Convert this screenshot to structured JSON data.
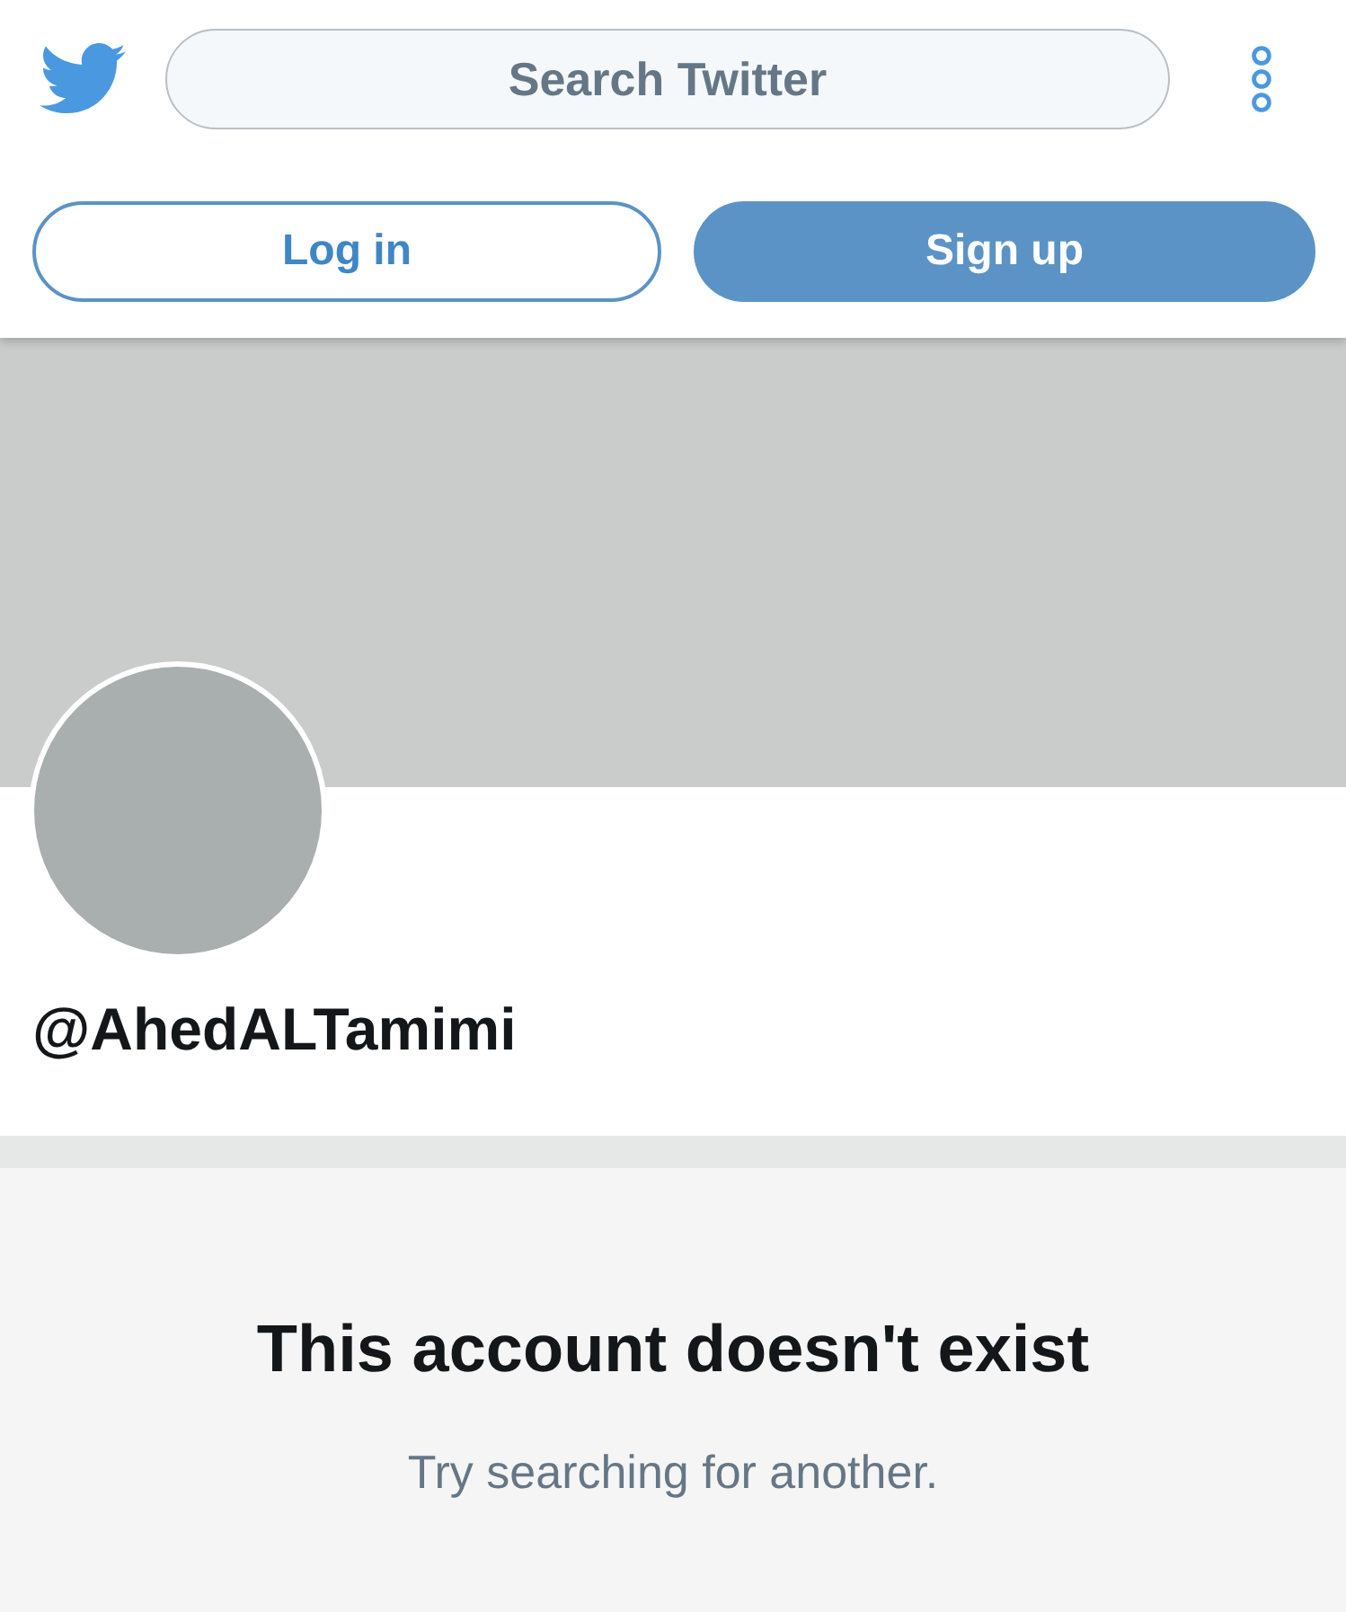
{
  "header": {
    "search": {
      "placeholder": "Search Twitter"
    }
  },
  "buttons": [
    {
      "label": "Log in",
      "kind": "outline"
    },
    {
      "label": "Sign up",
      "kind": "filled"
    }
  ],
  "profile": {
    "handle": "@AhedALTamimi"
  },
  "message": {
    "title": "This account doesn't exist",
    "subtitle": "Try searching for another."
  }
}
